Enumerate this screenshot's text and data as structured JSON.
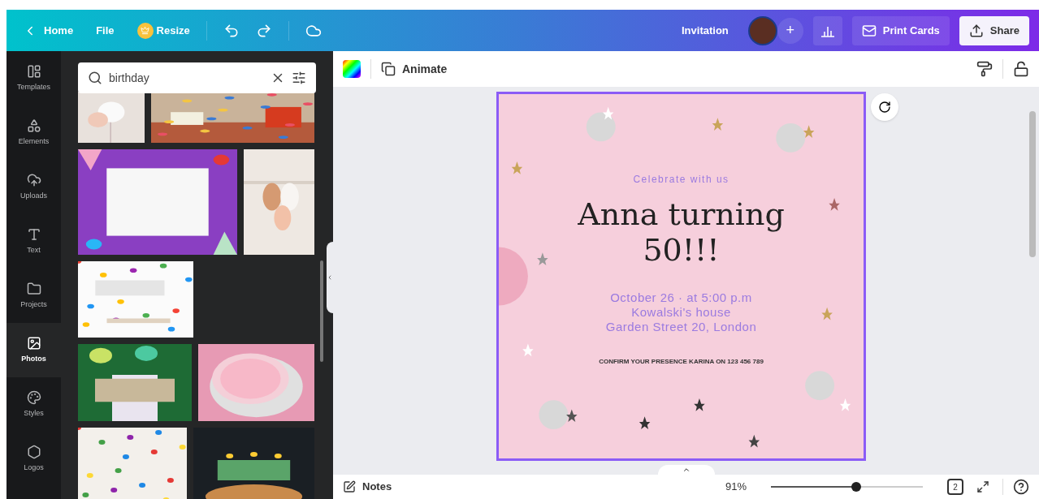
{
  "header": {
    "back": "Home",
    "file": "File",
    "resize": "Resize",
    "title": "Invitation",
    "add": "+",
    "print": "Print Cards",
    "share": "Share"
  },
  "rail": [
    {
      "label": "Templates",
      "selected": false
    },
    {
      "label": "Elements",
      "selected": false
    },
    {
      "label": "Uploads",
      "selected": false
    },
    {
      "label": "Text",
      "selected": false
    },
    {
      "label": "Projects",
      "selected": false
    },
    {
      "label": "Photos",
      "selected": true
    },
    {
      "label": "Styles",
      "selected": false
    },
    {
      "label": "Logos",
      "selected": false
    }
  ],
  "search": {
    "value": "birthday"
  },
  "toolbar": {
    "animate": "Animate"
  },
  "card": {
    "kicker": "Celebrate with us",
    "title": "Anna turning 50!!!",
    "details": [
      "October 26 · at 5:00 p.m",
      "Kowalski's house",
      "Garden Street 20, London"
    ],
    "note": "CONFIRM YOUR PRESENCE KARINA ON 123 456 789"
  },
  "footer": {
    "notes": "Notes",
    "zoom": "91%",
    "zoom_slider": {
      "level": 0.56
    },
    "pages": "2"
  }
}
